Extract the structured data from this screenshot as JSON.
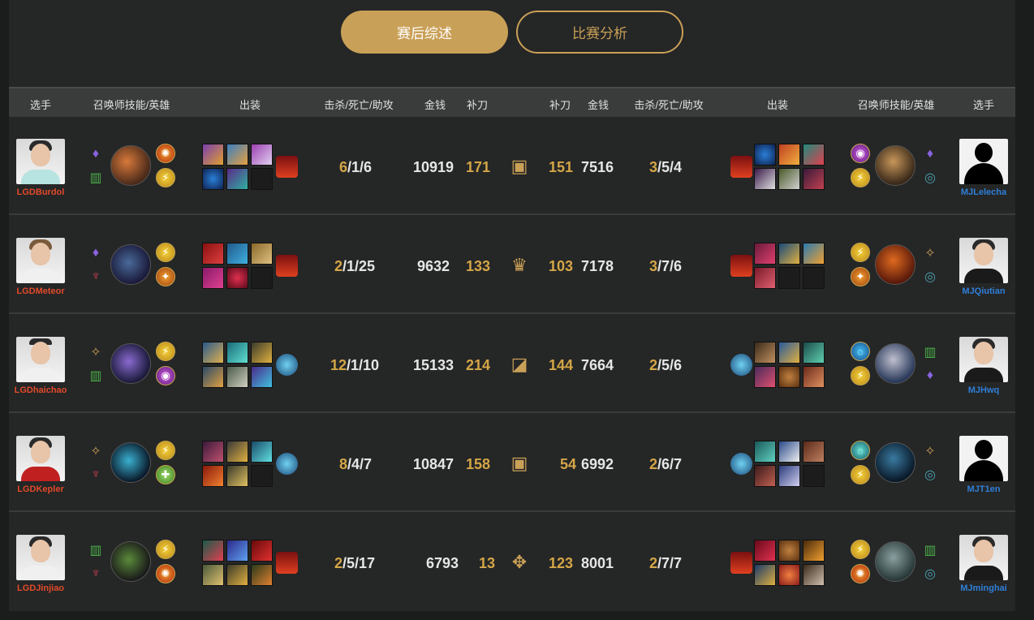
{
  "tabs": [
    {
      "label": "赛后综述",
      "active": true
    },
    {
      "label": "比赛分析",
      "active": false
    }
  ],
  "headers": {
    "player_left": "选手",
    "spells_left": "召唤师技能/英雄",
    "items_left": "出装",
    "kda_left": "击杀/死亡/助攻",
    "gold_left": "金钱",
    "cs_left": "补刀",
    "cs_right": "补刀",
    "gold_right": "金钱",
    "kda_right": "击杀/死亡/助攻",
    "items_right": "出装",
    "spells_right": "召唤师技能/英雄",
    "player_right": "选手"
  },
  "colors": {
    "accent": "#c9a057",
    "left_team": "#e24a2a",
    "right_team": "#2f7fd8"
  },
  "rows": [
    {
      "lane_icon": "top-lane-icon",
      "left": {
        "player": "LGDBurdol",
        "kills": "6",
        "rest": "/1/6",
        "gold": "10919",
        "cs": "171"
      },
      "right": {
        "player": "MJLelecha",
        "kills": "3",
        "rest": "/5/4",
        "gold": "7516",
        "cs": "151"
      }
    },
    {
      "lane_icon": "jungle-icon",
      "left": {
        "player": "LGDMeteor",
        "kills": "2",
        "rest": "/1/25",
        "gold": "9632",
        "cs": "133"
      },
      "right": {
        "player": "MJQiutian",
        "kills": "3",
        "rest": "/7/6",
        "gold": "7178",
        "cs": "103"
      }
    },
    {
      "lane_icon": "mid-lane-icon",
      "left": {
        "player": "LGDhaichao",
        "kills": "12",
        "rest": "/1/10",
        "gold": "15133",
        "cs": "214"
      },
      "right": {
        "player": "MJHwq",
        "kills": "2",
        "rest": "/5/6",
        "gold": "7664",
        "cs": "144"
      }
    },
    {
      "lane_icon": "bot-lane-icon",
      "left": {
        "player": "LGDKepler",
        "kills": "8",
        "rest": "/4/7",
        "gold": "10847",
        "cs": "158"
      },
      "right": {
        "player": "MJT1en",
        "kills": "2",
        "rest": "/6/7",
        "gold": "6992",
        "cs": "54"
      }
    },
    {
      "lane_icon": "support-icon",
      "left": {
        "player": "LGDJinjiao",
        "kills": "2",
        "rest": "/5/17",
        "gold": "6793",
        "cs": "13"
      },
      "right": {
        "player": "MJminghai",
        "kills": "2",
        "rest": "/7/7",
        "gold": "8001",
        "cs": "123"
      }
    }
  ]
}
